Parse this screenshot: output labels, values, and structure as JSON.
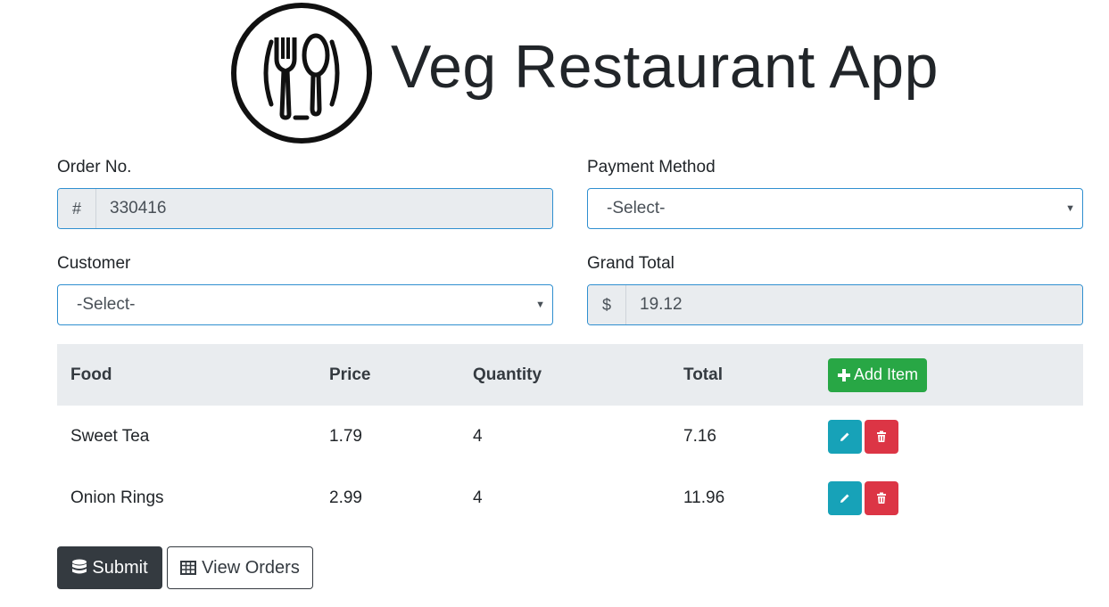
{
  "app": {
    "title": "Veg Restaurant App",
    "logo_icon": "fork-spoon-plate-icon"
  },
  "form": {
    "order_no": {
      "label": "Order No.",
      "prefix": "#",
      "value": "330416"
    },
    "payment_method": {
      "label": "Payment Method",
      "selected": "-Select-"
    },
    "customer": {
      "label": "Customer",
      "selected": "-Select-"
    },
    "grand_total": {
      "label": "Grand Total",
      "prefix": "$",
      "value": "19.12"
    }
  },
  "table": {
    "headers": {
      "food": "Food",
      "price": "Price",
      "quantity": "Quantity",
      "total": "Total"
    },
    "add_item_label": "Add Item",
    "rows": [
      {
        "food": "Sweet Tea",
        "price": "1.79",
        "quantity": "4",
        "total": "7.16"
      },
      {
        "food": "Onion Rings",
        "price": "2.99",
        "quantity": "4",
        "total": "11.96"
      }
    ]
  },
  "actions": {
    "submit_label": "Submit",
    "view_orders_label": "View Orders"
  },
  "colors": {
    "success": "#28a745",
    "info": "#17a2b8",
    "danger": "#dc3545",
    "dark": "#343a40",
    "focus_border": "#2f8fd0"
  }
}
